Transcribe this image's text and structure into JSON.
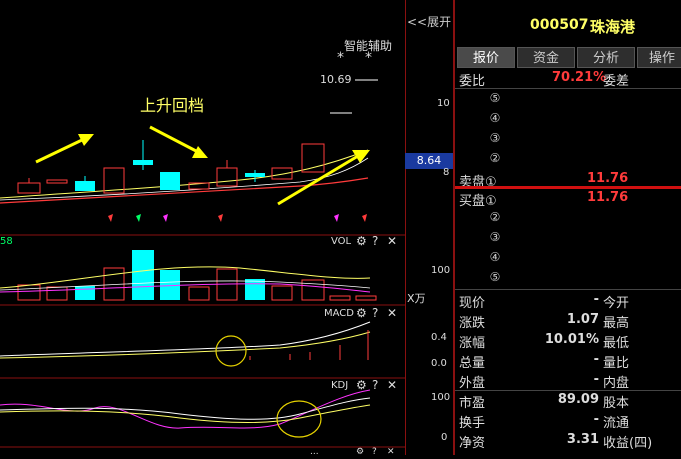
{
  "header": {
    "expand_label": "<<展开",
    "stock_code": "000507",
    "stock_name": "珠海港"
  },
  "chart": {
    "assist_label": "智能辅助",
    "star_marks": [
      "*",
      "*"
    ],
    "annotation": "上升回档",
    "price_label": "10.69",
    "vol_indicator": "VOL",
    "vol_left_value": "58",
    "macd_indicator": "MACD",
    "kdj_indicator": "KDJ",
    "bottom_indicator": "..."
  },
  "axis": {
    "price_ticks": [
      "10",
      "8"
    ],
    "current_price": "8.64",
    "vol_tick": "100",
    "vol_unit": "X万",
    "macd_ticks": [
      "0.4",
      "0.0"
    ],
    "kdj_ticks": [
      "100",
      "0"
    ]
  },
  "quote": {
    "tabs": [
      "报价",
      "资金",
      "分析",
      "操作"
    ],
    "wei_bi_label": "委比",
    "wei_bi_value": "70.21%",
    "wei_cha_label": "委差",
    "sell_levels": [
      "⑤",
      "④",
      "③",
      "②"
    ],
    "sell1_label": "卖盘①",
    "sell1_price": "11.76",
    "buy1_label": "买盘①",
    "buy1_price": "11.76",
    "buy_levels": [
      "②",
      "③",
      "④",
      "⑤"
    ],
    "stats": [
      {
        "l1": "现价",
        "v1": "-",
        "l2": "今开",
        "v1_red": false
      },
      {
        "l1": "涨跌",
        "v1": "1.07",
        "l2": "最高",
        "v1_red": false
      },
      {
        "l1": "涨幅",
        "v1": "10.01%",
        "l2": "最低",
        "v1_red": false
      },
      {
        "l1": "总量",
        "v1": "-",
        "l2": "量比",
        "v1_red": false
      },
      {
        "l1": "外盘",
        "v1": "-",
        "l2": "内盘",
        "v1_red": false
      },
      {
        "l1": "市盈",
        "v1": "89.09",
        "l2": "股本",
        "v1_red": false
      },
      {
        "l1": "换手",
        "v1": "-",
        "l2": "流通",
        "v1_red": false
      },
      {
        "l1": "净资",
        "v1": "3.31",
        "l2": "收益(四)",
        "v1_red": false
      }
    ]
  },
  "colors": {
    "up": "#ff3b3b",
    "down": "#00ffff",
    "arrow": "#ffff00",
    "magenta": "#ff33ff"
  }
}
